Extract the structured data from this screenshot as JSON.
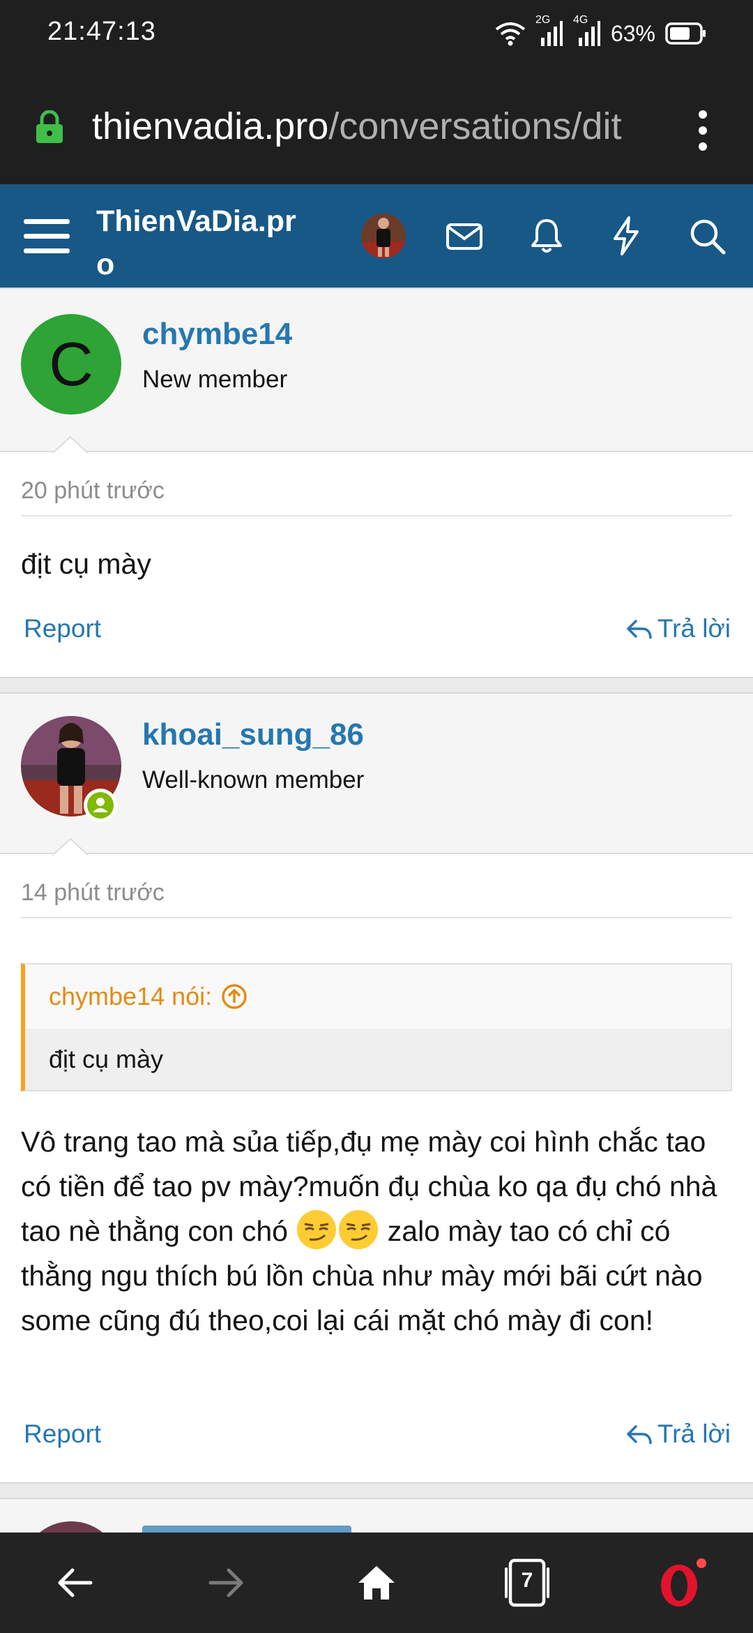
{
  "status_bar": {
    "time": "21:47:13",
    "network_2g": "2G",
    "network_4g": "4G",
    "battery": "63%"
  },
  "browser": {
    "url_domain": "thienvadia.pro",
    "url_path": "/conversations/dit"
  },
  "site": {
    "logo": "ThienVaDia.pro",
    "brand_color": "#185886",
    "link_color": "#2577b1"
  },
  "posts": [
    {
      "avatar_letter": "C",
      "avatar_color": "#2ea336",
      "username": "chymbe14",
      "user_title": "New member",
      "time": "20 phút trước",
      "body": "địt cụ mày",
      "report_label": "Report",
      "reply_label": "Trả lời"
    },
    {
      "username": "khoai_sung_86",
      "user_title": "Well-known member",
      "time": "14 phút trước",
      "quote": {
        "author": "chymbe14 nói:",
        "text": "địt cụ mày"
      },
      "body_part1": "Vô trang tao mà sủa tiếp,đụ mẹ mày coi hình chắc tao có tiền để tao pv mày?muốn đụ chùa ko qa đụ chó nhà tao nè thằng con chó ",
      "body_part2": " zalo mày tao có chỉ có thằng ngu thích bú lồn chùa như mày mới bãi cứt nào some cũng đú theo,coi lại cái mặt chó mày đi con!",
      "emoji": "smirk-face-emoji",
      "report_label": "Report",
      "reply_label": "Trả lời"
    }
  ],
  "bottom_nav": {
    "tab_count": "7"
  }
}
